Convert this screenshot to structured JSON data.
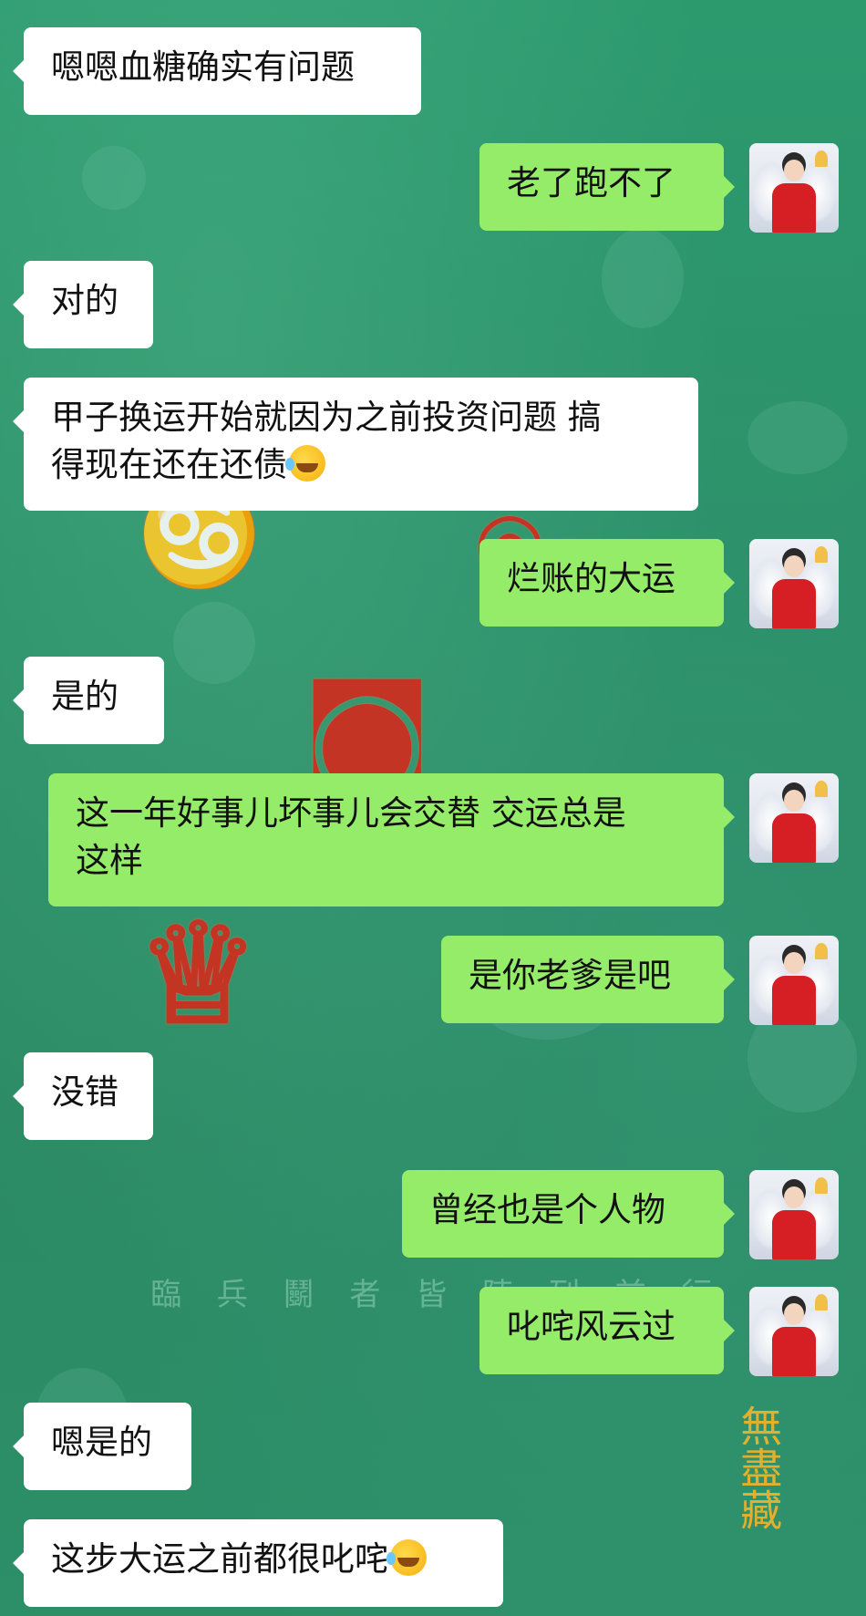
{
  "messages": [
    {
      "side": "in",
      "text": "嗯嗯血糖确实有问题"
    },
    {
      "side": "out",
      "text": "老了跑不了"
    },
    {
      "side": "in",
      "text": "对的"
    },
    {
      "side": "in",
      "line1": "甲子换运开始就因为之前投资问题 搞",
      "line2": "得现在还在还债",
      "emoji": "rolling-on-floor-laughing"
    },
    {
      "side": "out",
      "text": "烂账的大运"
    },
    {
      "side": "in",
      "text": "是的"
    },
    {
      "side": "out",
      "line1": "这一年好事儿坏事儿会交替 交运总是",
      "line2": "这样"
    },
    {
      "side": "out",
      "text": "是你老爹是吧"
    },
    {
      "side": "in",
      "text": "没错"
    },
    {
      "side": "out",
      "text": "曾经也是个人物"
    },
    {
      "side": "out",
      "text": "叱咤风云过"
    },
    {
      "side": "in",
      "text": "嗯是的"
    },
    {
      "side": "in",
      "text": "这步大运之前都很叱咤",
      "emoji": "rolling-on-floor-laughing"
    }
  ],
  "background": {
    "watermark_text": "臨 兵 鬭 者 皆 陣 列 前 行",
    "seal_text": "無盡藏",
    "colors": {
      "green": "#2f9468",
      "bubble_in": "#ffffff",
      "bubble_out": "#95ec69",
      "red": "#d42a1c"
    }
  },
  "avatar": {
    "icon": "avatar-woman-red-dress"
  }
}
